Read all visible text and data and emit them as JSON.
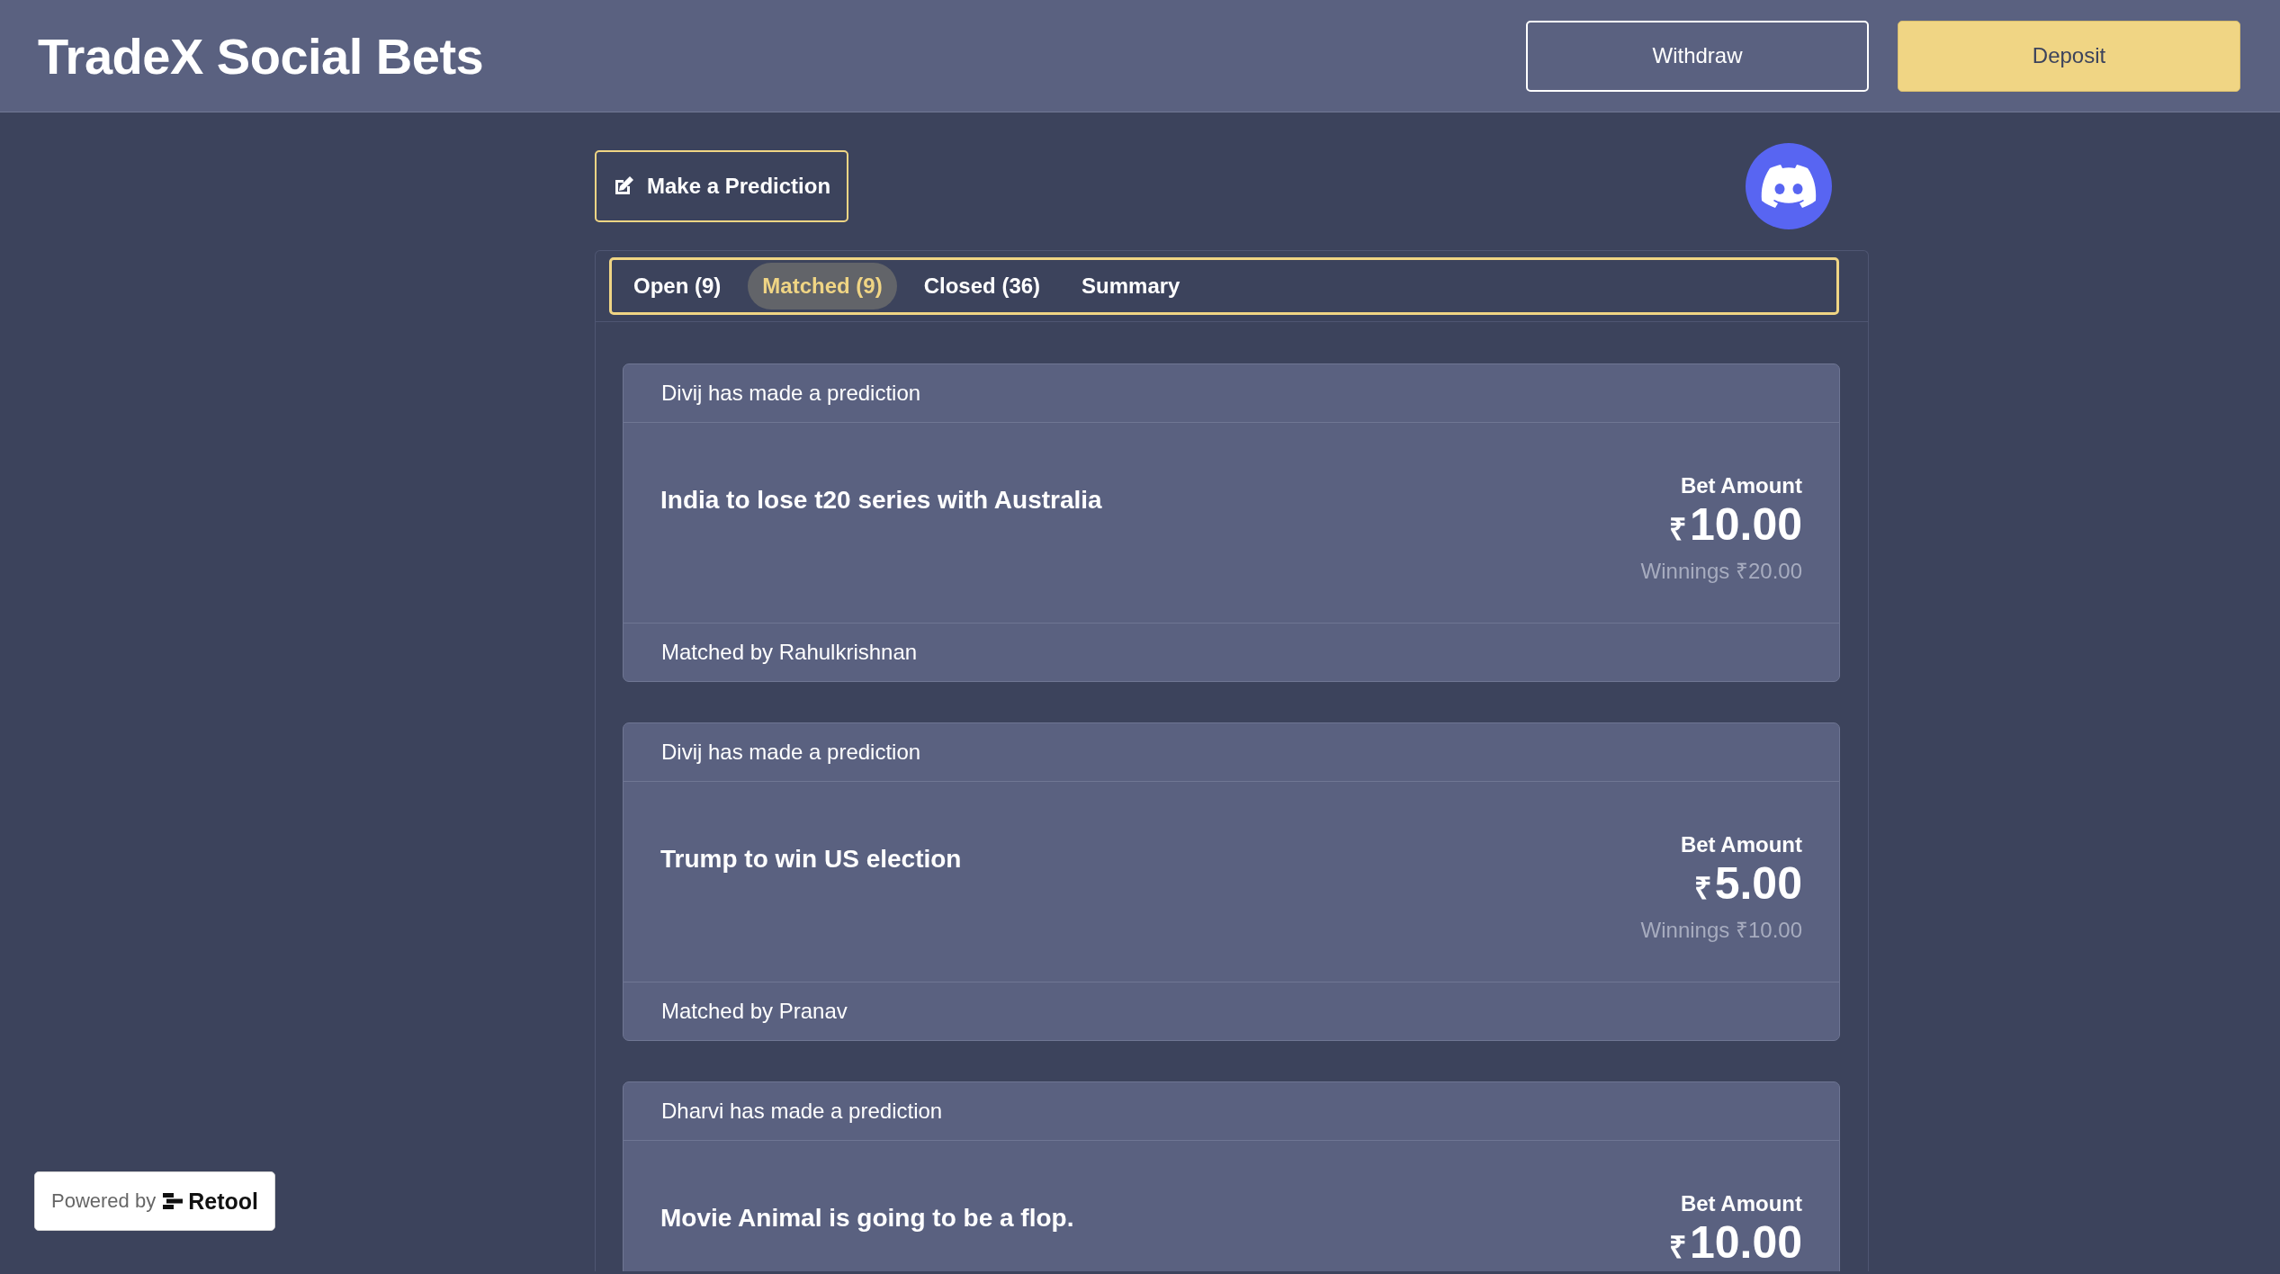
{
  "header": {
    "title": "TradeX Social Bets",
    "buttons": [
      {
        "label": "Withdraw",
        "kind": "outline"
      },
      {
        "label": "Deposit",
        "kind": "primary"
      }
    ]
  },
  "make_prediction": {
    "label": "Make a Prediction"
  },
  "tabs": [
    {
      "label": "Open (9)",
      "selected": false
    },
    {
      "label": "Matched (9)",
      "selected": true
    },
    {
      "label": "Closed (36)",
      "selected": false
    },
    {
      "label": "Summary",
      "selected": false
    }
  ],
  "bets": [
    {
      "header": "Divij has made a prediction",
      "title": "India to lose t20 series with Australia",
      "amount_label": "Bet Amount",
      "currency": "₹",
      "amount": "10.00",
      "winnings": "Winnings ₹20.00",
      "footer": "Matched by Rahulkrishnan"
    },
    {
      "header": "Divij has made a prediction",
      "title": "Trump to win US election",
      "amount_label": "Bet Amount",
      "currency": "₹",
      "amount": "5.00",
      "winnings": "Winnings ₹10.00",
      "footer": "Matched by Pranav"
    },
    {
      "header": "Dharvi has made a prediction",
      "title": "Movie Animal is going to be a flop.",
      "amount_label": "Bet Amount",
      "currency": "₹",
      "amount": "10.00"
    }
  ],
  "powered_by": {
    "text": "Powered by",
    "brand": "Retool"
  }
}
